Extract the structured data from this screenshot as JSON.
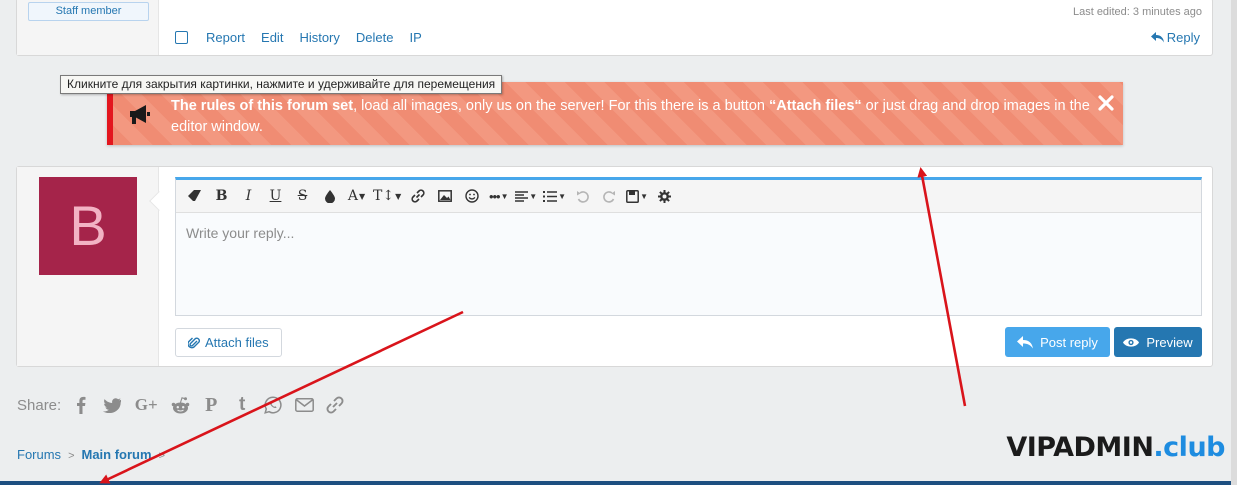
{
  "post": {
    "staff_badge": "Staff member",
    "last_edited": "Last edited: 3 minutes ago",
    "actions": [
      "Report",
      "Edit",
      "History",
      "Delete",
      "IP"
    ],
    "reply": "Reply"
  },
  "tooltip": "Кликните для закрытия картинки, нажмите и удерживайте для перемещения",
  "notice": {
    "bold_lead": "The rules of this forum set",
    "text_mid": ", load all images, only us on the server! For this there is a button ",
    "bold_button": "“Attach files“",
    "text_end": " or just drag and drop images in the editor window.",
    "accent_color": "#e3161e"
  },
  "editor": {
    "avatar_letter": "B",
    "placeholder": "Write your reply...",
    "attach_label": "Attach files",
    "post_label": "Post reply",
    "preview_label": "Preview",
    "toolbar": [
      {
        "icon": "eraser-icon"
      },
      {
        "label": "B"
      },
      {
        "label": "I"
      },
      {
        "label": "U"
      },
      {
        "label": "S"
      },
      {
        "icon": "color-drop-icon"
      },
      {
        "label": "A"
      },
      {
        "label": "T↕"
      },
      {
        "icon": "link-icon"
      },
      {
        "icon": "image-icon"
      },
      {
        "icon": "smiley-icon"
      },
      {
        "icon": "more-icon"
      },
      {
        "icon": "align-icon"
      },
      {
        "icon": "list-icon"
      },
      {
        "icon": "undo-icon"
      },
      {
        "icon": "redo-icon"
      },
      {
        "icon": "save-draft-icon"
      },
      {
        "icon": "settings-icon"
      }
    ]
  },
  "share": {
    "label": "Share:",
    "networks": [
      "facebook-icon",
      "twitter-icon",
      "google-plus-icon",
      "reddit-icon",
      "pinterest-icon",
      "tumblr-icon",
      "whatsapp-icon",
      "email-icon",
      "link-icon"
    ]
  },
  "breadcrumb": {
    "items": [
      "Forums",
      "Main forum"
    ]
  },
  "watermark": {
    "main": "VIPADMIN",
    "tld": ".club"
  }
}
